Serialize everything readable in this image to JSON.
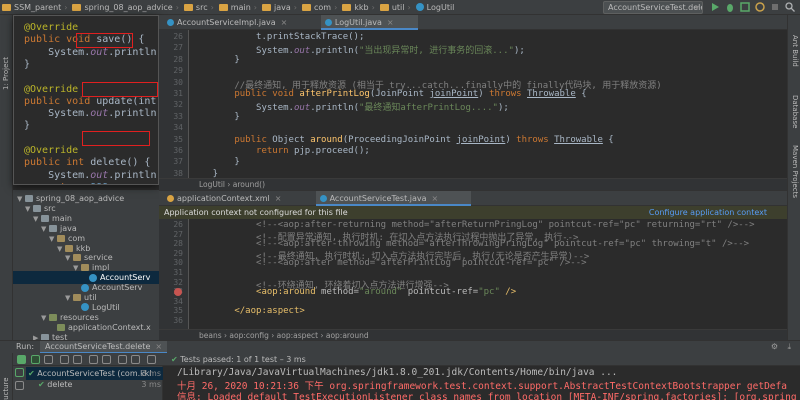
{
  "navbar": {
    "crumbs": [
      "SSM_parent",
      "spring_08_aop_advice",
      "src",
      "main",
      "java",
      "com",
      "kkb",
      "util",
      "LogUtil"
    ],
    "run_config": "AccountServiceTest.delete"
  },
  "left_strip": {
    "project_label": "1: Project",
    "structure_label": "Structure"
  },
  "right_strip": {
    "labels": [
      "Ant Build",
      "Database",
      "Maven Projects"
    ]
  },
  "popup": {
    "lines": [
      {
        "parts": [
          {
            "c": "ann",
            "t": "@Override"
          }
        ]
      },
      {
        "parts": [
          {
            "c": "kw",
            "t": "public void "
          },
          {
            "c": "",
            "t": "save() {"
          }
        ]
      },
      {
        "parts": [
          {
            "c": "",
            "t": "    System."
          },
          {
            "c": "fld",
            "t": "out"
          },
          {
            "c": "",
            "t": ".println(\""
          }
        ]
      },
      {
        "parts": [
          {
            "c": "",
            "t": "}"
          }
        ]
      },
      {
        "parts": [
          {
            "c": "",
            "t": ""
          }
        ]
      },
      {
        "parts": [
          {
            "c": "ann",
            "t": "@Override"
          }
        ]
      },
      {
        "parts": [
          {
            "c": "kw",
            "t": "public void "
          },
          {
            "c": "",
            "t": "update(int i)"
          }
        ]
      },
      {
        "parts": [
          {
            "c": "",
            "t": "    System."
          },
          {
            "c": "fld",
            "t": "out"
          },
          {
            "c": "",
            "t": ".println(\""
          }
        ]
      },
      {
        "parts": [
          {
            "c": "",
            "t": "}"
          }
        ]
      },
      {
        "parts": [
          {
            "c": "",
            "t": ""
          }
        ]
      },
      {
        "parts": [
          {
            "c": "ann",
            "t": "@Override"
          }
        ]
      },
      {
        "parts": [
          {
            "c": "kw",
            "t": "public int "
          },
          {
            "c": "",
            "t": "delete() {"
          }
        ]
      },
      {
        "parts": [
          {
            "c": "",
            "t": "    System."
          },
          {
            "c": "fld",
            "t": "out"
          },
          {
            "c": "",
            "t": ".println(\""
          }
        ]
      },
      {
        "parts": [
          {
            "c": "kw",
            "t": "    return "
          },
          {
            "c": "num",
            "t": "999"
          },
          {
            "c": "",
            "t": ";"
          }
        ]
      }
    ]
  },
  "tree": {
    "rows": [
      {
        "indent": 0,
        "arrow": "▼",
        "icon": "folder",
        "label": "spring_08_aop_advice"
      },
      {
        "indent": 1,
        "arrow": "▼",
        "icon": "folder",
        "label": "src"
      },
      {
        "indent": 2,
        "arrow": "▼",
        "icon": "folder",
        "label": "main"
      },
      {
        "indent": 3,
        "arrow": "▼",
        "icon": "folder",
        "label": "java"
      },
      {
        "indent": 4,
        "arrow": "▼",
        "icon": "pkg",
        "label": "com"
      },
      {
        "indent": 5,
        "arrow": "▼",
        "icon": "pkg",
        "label": "kkb"
      },
      {
        "indent": 6,
        "arrow": "▼",
        "icon": "pkg",
        "label": "service"
      },
      {
        "indent": 7,
        "arrow": "▼",
        "icon": "pkg",
        "label": "impl"
      },
      {
        "indent": 8,
        "arrow": "",
        "icon": "cls",
        "label": "AccountServ",
        "selected": true
      },
      {
        "indent": 7,
        "arrow": "",
        "icon": "cls",
        "label": "AccountServ"
      },
      {
        "indent": 6,
        "arrow": "▼",
        "icon": "pkg",
        "label": "util"
      },
      {
        "indent": 7,
        "arrow": "",
        "icon": "cls",
        "label": "LogUtil"
      },
      {
        "indent": 3,
        "arrow": "▼",
        "icon": "res",
        "label": "resources"
      },
      {
        "indent": 4,
        "arrow": "",
        "icon": "res",
        "label": "applicationContext.x"
      },
      {
        "indent": 2,
        "arrow": "▶",
        "icon": "folder",
        "label": "test"
      }
    ]
  },
  "editor_top": {
    "tabs": [
      {
        "label": "AccountServiceImpl.java",
        "active": false,
        "color": "#3592c4"
      },
      {
        "label": "LogUtil.java",
        "active": true,
        "color": "#3592c4"
      }
    ],
    "line_numbers": [
      "26",
      "27",
      "28",
      "29",
      "30",
      "31",
      "32",
      "33",
      "34",
      "35",
      "36",
      "37",
      "38"
    ],
    "lines": [
      [
        {
          "c": "",
          "t": "            t.printStackTrace();"
        }
      ],
      [
        {
          "c": "",
          "t": "            System."
        },
        {
          "c": "fld",
          "t": "out"
        },
        {
          "c": "",
          "t": ".println("
        },
        {
          "c": "str",
          "t": "\"当出现异常时, 进行事务的回滚...\""
        },
        {
          "c": "",
          "t": ");"
        }
      ],
      [
        {
          "c": "",
          "t": "        }"
        }
      ],
      [
        {
          "c": "",
          "t": ""
        }
      ],
      [
        {
          "c": "cmt",
          "t": "        //最终通知, 用于释放资源 (相当于 try...catch...finally中的 finally代码块, 用于释放资源)"
        }
      ],
      [
        {
          "c": "kw",
          "t": "        public void "
        },
        {
          "c": "fn",
          "t": "afterPrintLog"
        },
        {
          "c": "",
          "t": "(JoinPoint "
        },
        {
          "c": "prm",
          "t": "joinPoint"
        },
        {
          "c": "",
          "t": ") "
        },
        {
          "c": "kw",
          "t": "throws "
        },
        {
          "c": "bolder",
          "t": "Throwable"
        },
        {
          "c": "",
          "t": " {"
        }
      ],
      [
        {
          "c": "",
          "t": "            System."
        },
        {
          "c": "fld",
          "t": "out"
        },
        {
          "c": "",
          "t": ".println("
        },
        {
          "c": "str",
          "t": "\"最终通知afterPrintLog....\""
        },
        {
          "c": "",
          "t": ");"
        }
      ],
      [
        {
          "c": "",
          "t": "        }"
        }
      ],
      [
        {
          "c": "",
          "t": ""
        }
      ],
      [
        {
          "c": "kw",
          "t": "        public "
        },
        {
          "c": "",
          "t": "Object "
        },
        {
          "c": "fn",
          "t": "around"
        },
        {
          "c": "",
          "t": "(ProceedingJoinPoint "
        },
        {
          "c": "prm",
          "t": "joinPoint"
        },
        {
          "c": "",
          "t": ") "
        },
        {
          "c": "kw",
          "t": "throws "
        },
        {
          "c": "bolder",
          "t": "Throwable"
        },
        {
          "c": "",
          "t": " {"
        }
      ],
      [
        {
          "c": "kw",
          "t": "            return "
        },
        {
          "c": "",
          "t": "pjp.proceed();"
        }
      ],
      [
        {
          "c": "",
          "t": "        }"
        }
      ],
      [
        {
          "c": "",
          "t": "    }"
        }
      ]
    ],
    "breadcrumb": [
      "LogUtil",
      "around()"
    ]
  },
  "editor_bottom": {
    "tabs": [
      {
        "label": "applicationContext.xml",
        "active": false,
        "color": "#d9a343"
      },
      {
        "label": "AccountServiceTest.java",
        "active": true,
        "color": "#3592c4"
      }
    ],
    "banner": "Application context not configured for this file",
    "banner_link": "Configure application context",
    "line_numbers": [
      "26",
      "27",
      "28",
      "29",
      "30",
      "31",
      "32",
      "33",
      "34",
      "35",
      "36"
    ],
    "lines": [
      [
        {
          "c": "xml-c",
          "t": "            <!--<aop:after-returning method=\"afterReturnPringLog\" pointcut-ref=\"pc\" returning=\"rt\" />-->"
        }
      ],
      [
        {
          "c": "xml-c",
          "t": "            <!--配置异常通知, 执行时机: 在切入点方法执行过程中抛出了异常, 执行-->"
        }
      ],
      [
        {
          "c": "xml-c",
          "t": "            <!--<aop:after-throwing method=\"afterThrowingPringLog\" pointcut-ref=\"pc\" throwing=\"t\" />-->"
        }
      ],
      [
        {
          "c": "xml-c",
          "t": "            <!--最终通知, 执行时机: 切入点方法执行完毕后, 执行(无论是否产生异常)-->"
        }
      ],
      [
        {
          "c": "xml-c",
          "t": "            <!--<aop:after method=\"afterPrintLog\" pointcut-ref=\"pc\" />-->"
        }
      ],
      [
        {
          "c": "",
          "t": ""
        }
      ],
      [
        {
          "c": "xml-c",
          "t": "            <!--环绕通知, 环绕着切入点方法进行增强-->"
        }
      ],
      [
        {
          "c": "xml-t",
          "t": "            <aop:around "
        },
        {
          "c": "xml-a",
          "t": "method="
        },
        {
          "c": "xml-v",
          "t": "\"around\""
        },
        {
          "c": "xml-a",
          "t": " pointcut-ref="
        },
        {
          "c": "xml-v",
          "t": "\"pc\""
        },
        {
          "c": "xml-t",
          "t": " />"
        }
      ],
      [
        {
          "c": "",
          "t": ""
        }
      ],
      [
        {
          "c": "xml-t",
          "t": "        </aop:aspect>"
        }
      ],
      [
        {
          "c": "",
          "t": ""
        }
      ]
    ],
    "breadcrumb": [
      "beans",
      "aop:config",
      "aop:aspect",
      "aop:around"
    ]
  },
  "run_panel": {
    "label": "Run:",
    "config_tab": "AccountServiceTest.delete",
    "status": "Tests passed: 1 of 1 test – 3 ms",
    "tests": [
      {
        "label": "AccountServiceTest (com.kkl",
        "time": "3 ms"
      },
      {
        "label": "delete",
        "time": "3 ms"
      }
    ],
    "console": [
      {
        "color": "#bbbbbb",
        "text": "/Library/Java/JavaVirtualMachines/jdk1.8.0_201.jdk/Contents/Home/bin/java ..."
      },
      {
        "color": "#ff6b68",
        "text": "十月 26, 2020 10:21:36 下午 org.springframework.test.context.support.AbstractTestContextBootstrapper getDefa"
      },
      {
        "color": "#ff6b68",
        "text": "信息: Loaded default TestExecutionListener class names from location [META-INF/spring.factories]: [org.spring"
      }
    ]
  }
}
